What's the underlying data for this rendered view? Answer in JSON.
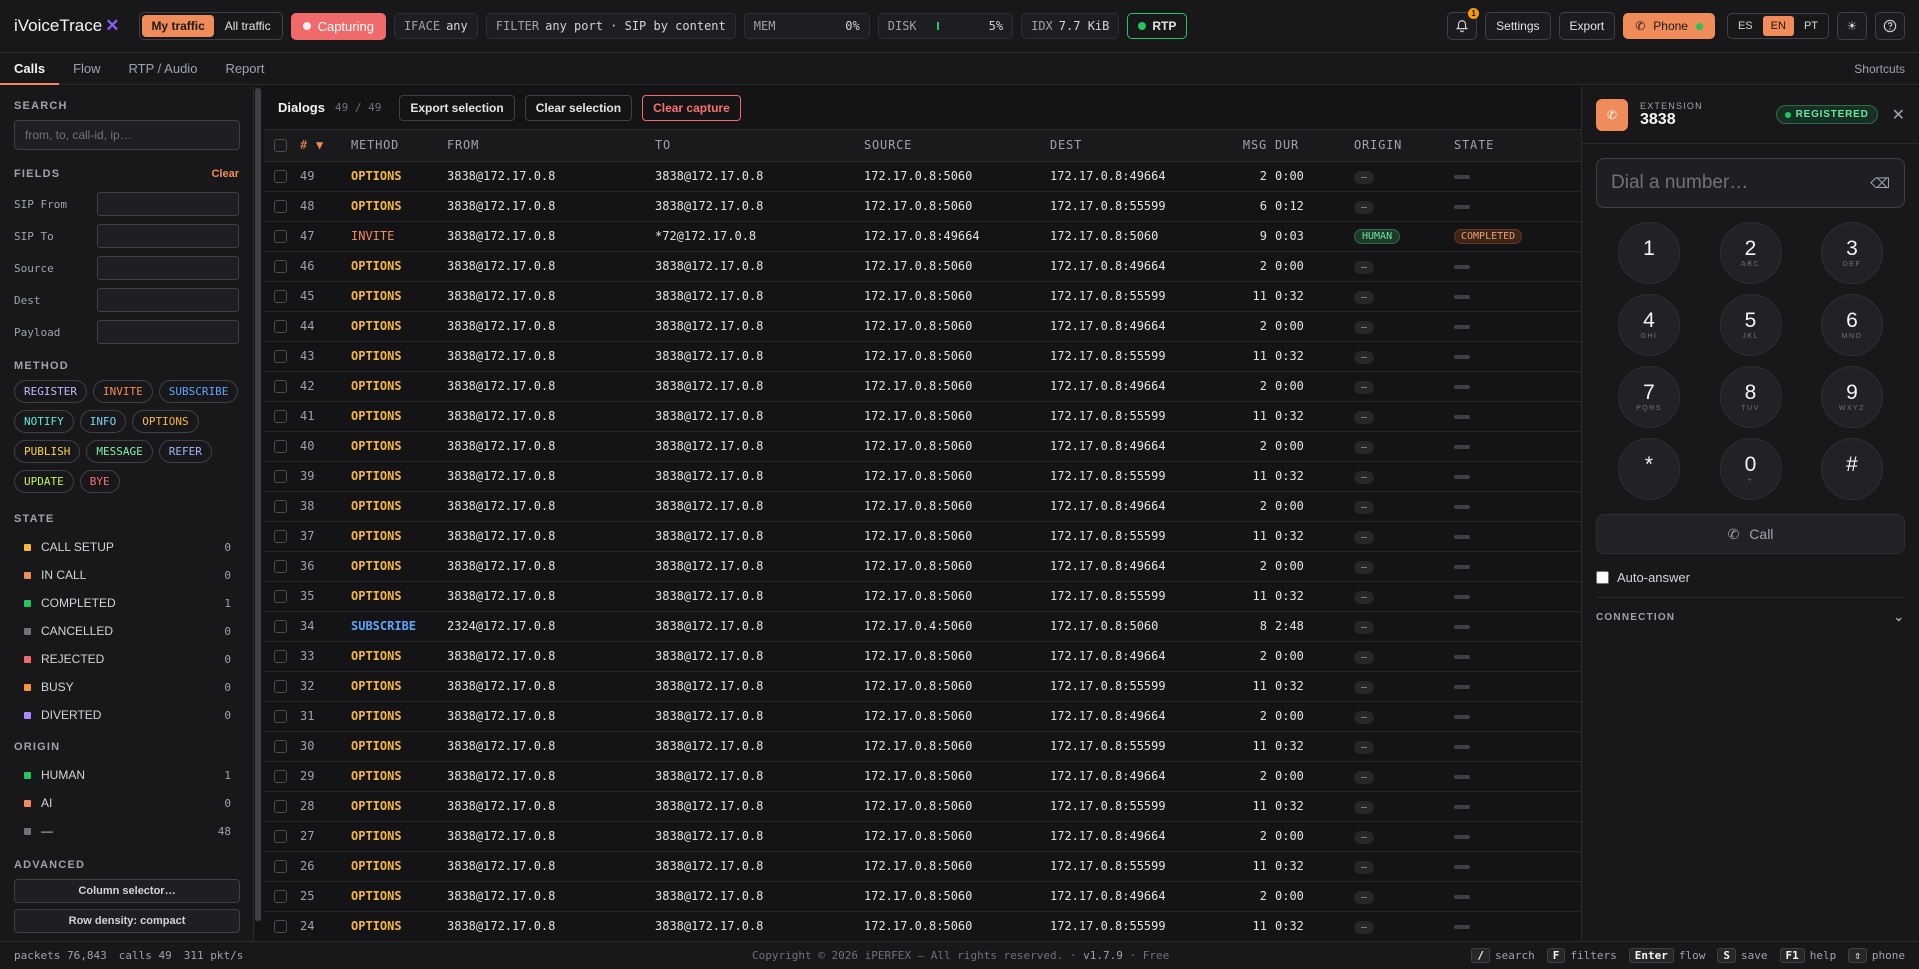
{
  "brand": {
    "name": "iVoiceTrace",
    "mark": "✕"
  },
  "topbar": {
    "traffic": [
      "My traffic",
      "All traffic"
    ],
    "capturing": "Capturing",
    "iface_label": "IFACE",
    "iface_value": "any",
    "filter_label": "FILTER",
    "filter_value": "any port · SIP by content",
    "mem_label": "MEM",
    "mem_value": "0%",
    "disk_label": "DISK",
    "disk_value": "5%",
    "idx_label": "IDX",
    "idx_value": "7.7 KiB",
    "rtp": "RTP",
    "notif_count": "1",
    "settings": "Settings",
    "export": "Export",
    "phone": "Phone",
    "langs": [
      "ES",
      "EN",
      "PT"
    ],
    "active_lang": "EN"
  },
  "tabs": [
    "Calls",
    "Flow",
    "RTP / Audio",
    "Report"
  ],
  "shortcuts": "Shortcuts",
  "sidebar": {
    "search_title": "SEARCH",
    "search_placeholder": "from, to, call-id, ip…",
    "fields_title": "FIELDS",
    "clear": "Clear",
    "fields": [
      "SIP From",
      "SIP To",
      "Source",
      "Dest",
      "Payload"
    ],
    "method_title": "METHOD",
    "methods": [
      {
        "name": "REGISTER",
        "color": "#c4b5fd"
      },
      {
        "name": "INVITE",
        "color": "#f08c5a"
      },
      {
        "name": "SUBSCRIBE",
        "color": "#60a5fa"
      },
      {
        "name": "NOTIFY",
        "color": "#5eead4"
      },
      {
        "name": "INFO",
        "color": "#7dd3fc"
      },
      {
        "name": "OPTIONS",
        "color": "#f5b642"
      },
      {
        "name": "PUBLISH",
        "color": "#fcd34d"
      },
      {
        "name": "MESSAGE",
        "color": "#86efac"
      },
      {
        "name": "REFER",
        "color": "#a5b4fc"
      },
      {
        "name": "UPDATE",
        "color": "#bef264"
      },
      {
        "name": "BYE",
        "color": "#f87171"
      }
    ],
    "state_title": "STATE",
    "states": [
      {
        "name": "CALL SETUP",
        "count": "0",
        "color": "#f5b642"
      },
      {
        "name": "IN CALL",
        "count": "0",
        "color": "#f08c5a"
      },
      {
        "name": "COMPLETED",
        "count": "1",
        "color": "#22c55e"
      },
      {
        "name": "CANCELLED",
        "count": "0",
        "color": "#71717a"
      },
      {
        "name": "REJECTED",
        "count": "0",
        "color": "#f06a6a"
      },
      {
        "name": "BUSY",
        "count": "0",
        "color": "#fb923c"
      },
      {
        "name": "DIVERTED",
        "count": "0",
        "color": "#a78bfa"
      }
    ],
    "origin_title": "ORIGIN",
    "origins": [
      {
        "name": "HUMAN",
        "count": "1",
        "color": "#22c55e"
      },
      {
        "name": "AI",
        "count": "0",
        "color": "#f08c5a"
      },
      {
        "name": "—",
        "count": "48",
        "color": "#71717a"
      }
    ],
    "advanced_title": "ADVANCED",
    "column_selector": "Column selector…",
    "row_density": "Row density: compact"
  },
  "main": {
    "title": "Dialogs",
    "count": "49 / 49",
    "export_selection": "Export selection",
    "clear_selection": "Clear selection",
    "clear_capture": "Clear capture",
    "columns": [
      "# ▼",
      "METHOD",
      "FROM",
      "TO",
      "SOURCE",
      "DEST",
      "MSG",
      "DUR",
      "ORIGIN",
      "STATE"
    ],
    "rows": [
      {
        "id": "49",
        "method": "OPTIONS",
        "from": "3838@172.17.0.8",
        "to": "3838@172.17.0.8",
        "source": "172.17.0.8:5060",
        "dest": "172.17.0.8:49664",
        "msg": "2",
        "dur": "0:00",
        "origin": "—",
        "state": ""
      },
      {
        "id": "48",
        "method": "OPTIONS",
        "from": "3838@172.17.0.8",
        "to": "3838@172.17.0.8",
        "source": "172.17.0.8:5060",
        "dest": "172.17.0.8:55599",
        "msg": "6",
        "dur": "0:12",
        "origin": "—",
        "state": ""
      },
      {
        "id": "47",
        "method": "INVITE",
        "from": "3838@172.17.0.8",
        "to": "*72@172.17.0.8",
        "source": "172.17.0.8:49664",
        "dest": "172.17.0.8:5060",
        "msg": "9",
        "dur": "0:03",
        "origin": "HUMAN",
        "state": "COMPLETED"
      },
      {
        "id": "46",
        "method": "OPTIONS",
        "from": "3838@172.17.0.8",
        "to": "3838@172.17.0.8",
        "source": "172.17.0.8:5060",
        "dest": "172.17.0.8:49664",
        "msg": "2",
        "dur": "0:00",
        "origin": "—",
        "state": ""
      },
      {
        "id": "45",
        "method": "OPTIONS",
        "from": "3838@172.17.0.8",
        "to": "3838@172.17.0.8",
        "source": "172.17.0.8:5060",
        "dest": "172.17.0.8:55599",
        "msg": "11",
        "dur": "0:32",
        "origin": "—",
        "state": ""
      },
      {
        "id": "44",
        "method": "OPTIONS",
        "from": "3838@172.17.0.8",
        "to": "3838@172.17.0.8",
        "source": "172.17.0.8:5060",
        "dest": "172.17.0.8:49664",
        "msg": "2",
        "dur": "0:00",
        "origin": "—",
        "state": ""
      },
      {
        "id": "43",
        "method": "OPTIONS",
        "from": "3838@172.17.0.8",
        "to": "3838@172.17.0.8",
        "source": "172.17.0.8:5060",
        "dest": "172.17.0.8:55599",
        "msg": "11",
        "dur": "0:32",
        "origin": "—",
        "state": ""
      },
      {
        "id": "42",
        "method": "OPTIONS",
        "from": "3838@172.17.0.8",
        "to": "3838@172.17.0.8",
        "source": "172.17.0.8:5060",
        "dest": "172.17.0.8:49664",
        "msg": "2",
        "dur": "0:00",
        "origin": "—",
        "state": ""
      },
      {
        "id": "41",
        "method": "OPTIONS",
        "from": "3838@172.17.0.8",
        "to": "3838@172.17.0.8",
        "source": "172.17.0.8:5060",
        "dest": "172.17.0.8:55599",
        "msg": "11",
        "dur": "0:32",
        "origin": "—",
        "state": ""
      },
      {
        "id": "40",
        "method": "OPTIONS",
        "from": "3838@172.17.0.8",
        "to": "3838@172.17.0.8",
        "source": "172.17.0.8:5060",
        "dest": "172.17.0.8:49664",
        "msg": "2",
        "dur": "0:00",
        "origin": "—",
        "state": ""
      },
      {
        "id": "39",
        "method": "OPTIONS",
        "from": "3838@172.17.0.8",
        "to": "3838@172.17.0.8",
        "source": "172.17.0.8:5060",
        "dest": "172.17.0.8:55599",
        "msg": "11",
        "dur": "0:32",
        "origin": "—",
        "state": ""
      },
      {
        "id": "38",
        "method": "OPTIONS",
        "from": "3838@172.17.0.8",
        "to": "3838@172.17.0.8",
        "source": "172.17.0.8:5060",
        "dest": "172.17.0.8:49664",
        "msg": "2",
        "dur": "0:00",
        "origin": "—",
        "state": ""
      },
      {
        "id": "37",
        "method": "OPTIONS",
        "from": "3838@172.17.0.8",
        "to": "3838@172.17.0.8",
        "source": "172.17.0.8:5060",
        "dest": "172.17.0.8:55599",
        "msg": "11",
        "dur": "0:32",
        "origin": "—",
        "state": ""
      },
      {
        "id": "36",
        "method": "OPTIONS",
        "from": "3838@172.17.0.8",
        "to": "3838@172.17.0.8",
        "source": "172.17.0.8:5060",
        "dest": "172.17.0.8:49664",
        "msg": "2",
        "dur": "0:00",
        "origin": "—",
        "state": ""
      },
      {
        "id": "35",
        "method": "OPTIONS",
        "from": "3838@172.17.0.8",
        "to": "3838@172.17.0.8",
        "source": "172.17.0.8:5060",
        "dest": "172.17.0.8:55599",
        "msg": "11",
        "dur": "0:32",
        "origin": "—",
        "state": ""
      },
      {
        "id": "34",
        "method": "SUBSCRIBE",
        "from": "2324@172.17.0.8",
        "to": "3838@172.17.0.8",
        "source": "172.17.0.4:5060",
        "dest": "172.17.0.8:5060",
        "msg": "8",
        "dur": "2:48",
        "origin": "—",
        "state": ""
      },
      {
        "id": "33",
        "method": "OPTIONS",
        "from": "3838@172.17.0.8",
        "to": "3838@172.17.0.8",
        "source": "172.17.0.8:5060",
        "dest": "172.17.0.8:49664",
        "msg": "2",
        "dur": "0:00",
        "origin": "—",
        "state": ""
      },
      {
        "id": "32",
        "method": "OPTIONS",
        "from": "3838@172.17.0.8",
        "to": "3838@172.17.0.8",
        "source": "172.17.0.8:5060",
        "dest": "172.17.0.8:55599",
        "msg": "11",
        "dur": "0:32",
        "origin": "—",
        "state": ""
      },
      {
        "id": "31",
        "method": "OPTIONS",
        "from": "3838@172.17.0.8",
        "to": "3838@172.17.0.8",
        "source": "172.17.0.8:5060",
        "dest": "172.17.0.8:49664",
        "msg": "2",
        "dur": "0:00",
        "origin": "—",
        "state": ""
      },
      {
        "id": "30",
        "method": "OPTIONS",
        "from": "3838@172.17.0.8",
        "to": "3838@172.17.0.8",
        "source": "172.17.0.8:5060",
        "dest": "172.17.0.8:55599",
        "msg": "11",
        "dur": "0:32",
        "origin": "—",
        "state": ""
      },
      {
        "id": "29",
        "method": "OPTIONS",
        "from": "3838@172.17.0.8",
        "to": "3838@172.17.0.8",
        "source": "172.17.0.8:5060",
        "dest": "172.17.0.8:49664",
        "msg": "2",
        "dur": "0:00",
        "origin": "—",
        "state": ""
      },
      {
        "id": "28",
        "method": "OPTIONS",
        "from": "3838@172.17.0.8",
        "to": "3838@172.17.0.8",
        "source": "172.17.0.8:5060",
        "dest": "172.17.0.8:55599",
        "msg": "11",
        "dur": "0:32",
        "origin": "—",
        "state": ""
      },
      {
        "id": "27",
        "method": "OPTIONS",
        "from": "3838@172.17.0.8",
        "to": "3838@172.17.0.8",
        "source": "172.17.0.8:5060",
        "dest": "172.17.0.8:49664",
        "msg": "2",
        "dur": "0:00",
        "origin": "—",
        "state": ""
      },
      {
        "id": "26",
        "method": "OPTIONS",
        "from": "3838@172.17.0.8",
        "to": "3838@172.17.0.8",
        "source": "172.17.0.8:5060",
        "dest": "172.17.0.8:55599",
        "msg": "11",
        "dur": "0:32",
        "origin": "—",
        "state": ""
      },
      {
        "id": "25",
        "method": "OPTIONS",
        "from": "3838@172.17.0.8",
        "to": "3838@172.17.0.8",
        "source": "172.17.0.8:5060",
        "dest": "172.17.0.8:49664",
        "msg": "2",
        "dur": "0:00",
        "origin": "—",
        "state": ""
      },
      {
        "id": "24",
        "method": "OPTIONS",
        "from": "3838@172.17.0.8",
        "to": "3838@172.17.0.8",
        "source": "172.17.0.8:5060",
        "dest": "172.17.0.8:55599",
        "msg": "11",
        "dur": "0:32",
        "origin": "—",
        "state": ""
      }
    ]
  },
  "dialer": {
    "ext_label": "EXTENSION",
    "ext_number": "3838",
    "status": "REGISTERED",
    "placeholder": "Dial a number…",
    "keys": [
      {
        "d": "1",
        "l": ""
      },
      {
        "d": "2",
        "l": "ABC"
      },
      {
        "d": "3",
        "l": "DEF"
      },
      {
        "d": "4",
        "l": "GHI"
      },
      {
        "d": "5",
        "l": "JKL"
      },
      {
        "d": "6",
        "l": "MNO"
      },
      {
        "d": "7",
        "l": "PQRS"
      },
      {
        "d": "8",
        "l": "TUV"
      },
      {
        "d": "9",
        "l": "WXYZ"
      },
      {
        "d": "*",
        "l": ""
      },
      {
        "d": "0",
        "l": "+"
      },
      {
        "d": "#",
        "l": ""
      }
    ],
    "call": "Call",
    "auto_answer": "Auto-answer",
    "connection": "CONNECTION"
  },
  "footer": {
    "packets_label": "packets",
    "packets": "76,843",
    "calls_label": "calls",
    "calls": "49",
    "rate": "311 pkt/s",
    "copyright": "Copyright © 2026 iPERFEX — All rights reserved. · ",
    "version": "v1.7.9",
    "edition": " · Free",
    "shortcuts": [
      {
        "key": "/",
        "label": "search"
      },
      {
        "key": "F",
        "label": "filters"
      },
      {
        "key": "Enter",
        "label": "flow"
      },
      {
        "key": "S",
        "label": "save"
      },
      {
        "key": "F1",
        "label": "help"
      },
      {
        "key": "⇧",
        "label": "phone"
      }
    ]
  }
}
